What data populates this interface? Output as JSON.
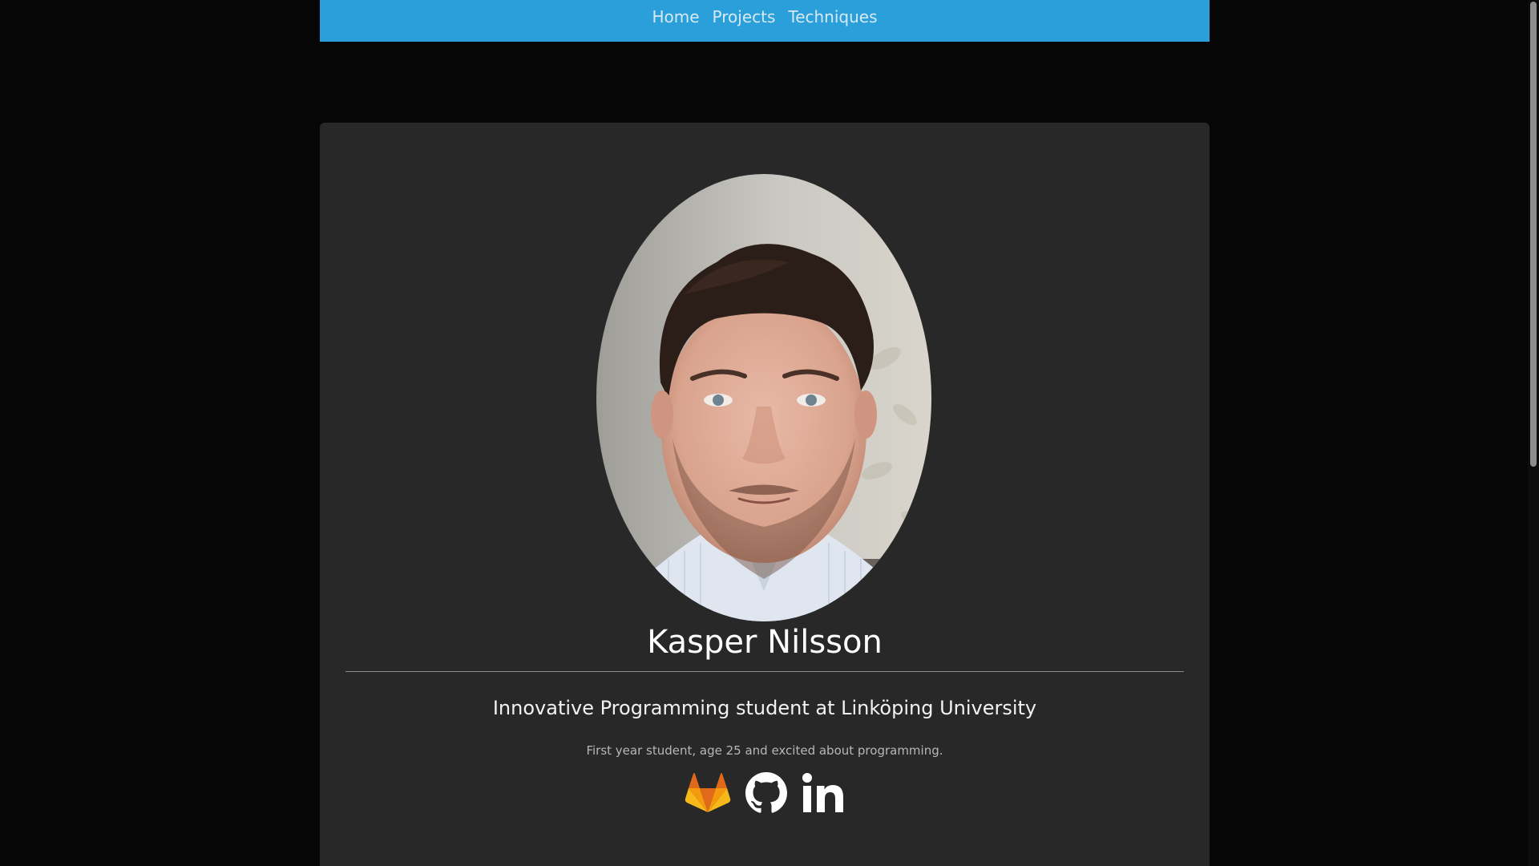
{
  "nav": {
    "items": [
      {
        "label": "Home"
      },
      {
        "label": "Projects"
      },
      {
        "label": "Techniques"
      }
    ],
    "color": "#2b9fd9"
  },
  "profile": {
    "name": "Kasper Nilsson",
    "subtitle": "Innovative Programming student at Linköping University",
    "tagline": "First year student, age 25 and excited about programming.",
    "photo_icon": "portrait-photo"
  },
  "socials": [
    {
      "icon": "gitlab-icon",
      "color": "#f5a20c"
    },
    {
      "icon": "github-icon",
      "color": "#ffffff"
    },
    {
      "icon": "linkedin-icon",
      "color": "#ffffff"
    }
  ],
  "colors": {
    "background": "#060606",
    "card": "#282828",
    "text": "#ffffff"
  }
}
